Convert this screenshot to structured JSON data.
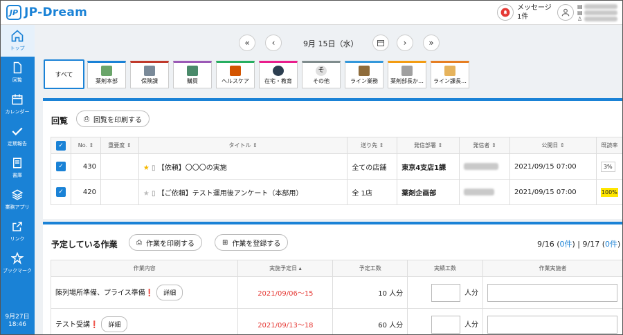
{
  "app": {
    "logo_mark": "JP",
    "brand": "JP-Dream"
  },
  "header": {
    "messages_label": "メッセージ",
    "messages_count": "1件"
  },
  "sidebar": {
    "items": [
      {
        "label": "トップ",
        "icon": "home-icon"
      },
      {
        "label": "回覧",
        "icon": "document-icon"
      },
      {
        "label": "カレンダー",
        "icon": "calendar-icon"
      },
      {
        "label": "定期報告",
        "icon": "check-icon"
      },
      {
        "label": "書庫",
        "icon": "book-icon"
      },
      {
        "label": "業務アプリ",
        "icon": "layers-icon"
      },
      {
        "label": "リンク",
        "icon": "external-link-icon"
      },
      {
        "label": "ブックマーク",
        "icon": "star-icon"
      }
    ],
    "date": "9月27日",
    "time": "18:46"
  },
  "date_nav": {
    "current_date": "9月 15日（水）",
    "first": "«",
    "prev": "‹",
    "next": "›",
    "last": "»"
  },
  "tabs": [
    {
      "label": "すべて"
    },
    {
      "label": "薬剤本部",
      "color": "#1a82d6",
      "icon_color": "#6aa56a"
    },
    {
      "label": "保険課",
      "color": "#c0392b",
      "icon_color": "#7a8a99"
    },
    {
      "label": "購買",
      "color": "#9b59b6",
      "icon_color": "#4a8a6a"
    },
    {
      "label": "ヘルスケア",
      "color": "#27ae60",
      "icon_color": "#d35400"
    },
    {
      "label": "在宅・教育",
      "color": "#e91e8c",
      "icon_color": "#2c3e50"
    },
    {
      "label": "その他",
      "color": "#7f8c8d",
      "icon_color": "#e0e0e0"
    },
    {
      "label": "ライン業務",
      "color": "#3498db",
      "icon_color": "#8e6b3a"
    },
    {
      "label": "薬剤部長か…",
      "color": "#f39c12",
      "icon_color": "#a0a0a0"
    },
    {
      "label": "ライン課長…",
      "color": "#e67e22",
      "icon_color": "#e6b35c"
    }
  ],
  "circulation": {
    "title": "回覧",
    "print_button": "回覧を印刷する",
    "columns": [
      "No.",
      "重要度",
      "タイトル",
      "送り先",
      "発信部署",
      "発信者",
      "公開日",
      "既読率"
    ],
    "rows": [
      {
        "no": "430",
        "title": "【依頼】〇〇〇の実施",
        "dest": "全ての店舗",
        "dept": "東京4支店1課",
        "date": "2021/09/15 07:00",
        "rate": "3%",
        "starred": true
      },
      {
        "no": "420",
        "title": "【ご依頼】テスト運用後アンケート（本部用）",
        "dest": "全 1店",
        "dept": "薬剤企画部",
        "date": "2021/09/15 07:00",
        "rate": "100%",
        "starred": false
      }
    ]
  },
  "tasks": {
    "title": "予定している作業",
    "print_button": "作業を印刷する",
    "register_button": "作業を登録する",
    "day1": "9/16 (",
    "day1_count": "0件",
    "day1_close": ")",
    "separator": " | ",
    "day2": "9/17 (",
    "day2_count": "0件",
    "day2_close": ")",
    "columns": [
      "作業内容",
      "実施予定日",
      "予定工数",
      "実績工数",
      "作業実施者"
    ],
    "rows": [
      {
        "content": "陳列場所準備、プライス準備",
        "mark": "❗",
        "detail": "詳細",
        "date": "2021/09/06〜15",
        "planned": "10  人分",
        "unit": "人分"
      },
      {
        "content": "テスト受講",
        "mark": "❗",
        "detail": "詳細",
        "date": "2021/09/13〜18",
        "planned": "60  人分",
        "unit": "人分"
      }
    ]
  },
  "colors": {
    "primary": "#1a82d6",
    "danger": "#e53935",
    "highlight": "#ffe600"
  }
}
